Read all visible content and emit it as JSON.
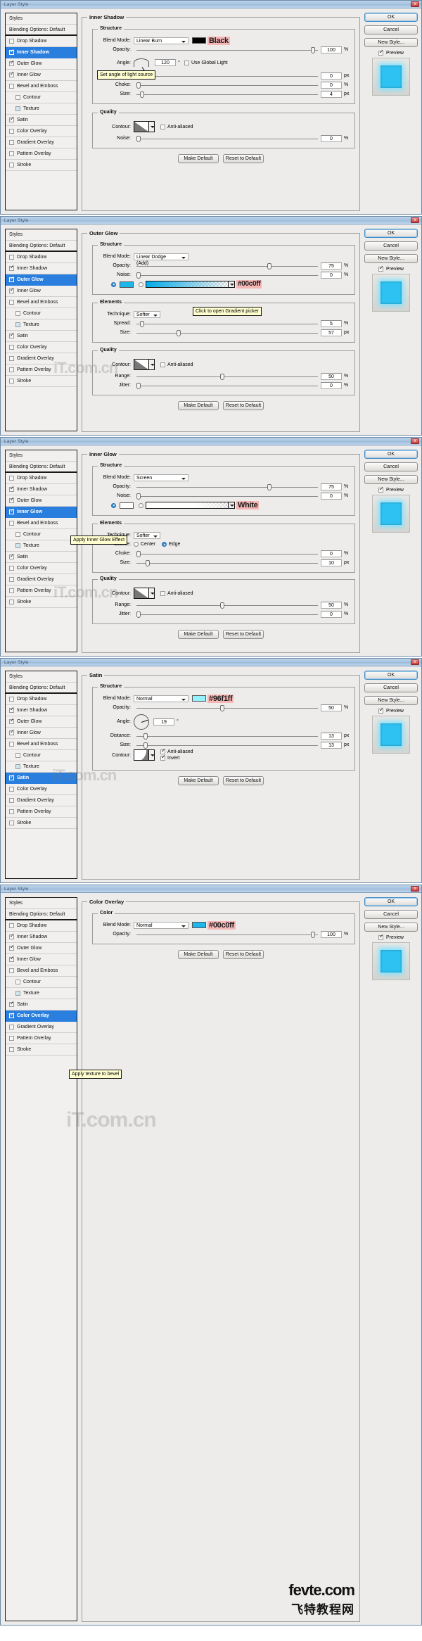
{
  "window": {
    "title": "Layer Style",
    "close_label": "x"
  },
  "styles_list": {
    "header": "Styles",
    "blending_options": "Blending Options: Default",
    "items": [
      {
        "label": "Drop Shadow",
        "checked": false,
        "indent": false
      },
      {
        "label": "Inner Shadow",
        "checked": true,
        "indent": false
      },
      {
        "label": "Outer Glow",
        "checked": true,
        "indent": false
      },
      {
        "label": "Inner Glow",
        "checked": true,
        "indent": false
      },
      {
        "label": "Bevel and Emboss",
        "checked": false,
        "indent": false
      },
      {
        "label": "Contour",
        "checked": false,
        "indent": true
      },
      {
        "label": "Texture",
        "checked": false,
        "indent": true
      },
      {
        "label": "Satin",
        "checked": true,
        "indent": false
      },
      {
        "label": "Color Overlay",
        "checked": true,
        "indent": false
      },
      {
        "label": "Gradient Overlay",
        "checked": false,
        "indent": false
      },
      {
        "label": "Pattern Overlay",
        "checked": false,
        "indent": false
      },
      {
        "label": "Stroke",
        "checked": false,
        "indent": false
      }
    ]
  },
  "buttons": {
    "ok": "OK",
    "cancel": "Cancel",
    "new_style": "New Style...",
    "preview": "Preview",
    "make_default": "Make Default",
    "reset_to_default": "Reset to Default"
  },
  "labels": {
    "structure": "Structure",
    "quality": "Quality",
    "elements": "Elements",
    "color": "Color",
    "blend_mode": "Blend Mode:",
    "opacity": "Opacity:",
    "angle": "Angle:",
    "distance": "Distance:",
    "choke": "Choke:",
    "size": "Size:",
    "spread": "Spread:",
    "noise": "Noise:",
    "contour": "Contour:",
    "technique": "Technique:",
    "source": "Source:",
    "range": "Range:",
    "jitter": "Jitter:",
    "anti_aliased": "Anti-aliased",
    "use_global_light": "Use Global Light",
    "invert": "Invert",
    "center": "Center",
    "edge": "Edge",
    "pct": "%",
    "px": "px",
    "deg": "°"
  },
  "panels": [
    {
      "id": "inner-shadow",
      "title": "Inner Shadow",
      "tooltip": "Set angle of light source",
      "selected_style": "Inner Shadow",
      "blend_mode": "Linear Burn",
      "color_tag": "Black",
      "color_hex": "#000000",
      "opacity": "100",
      "angle": "120",
      "distance": "0",
      "choke": "0",
      "size": "4",
      "noise": "0"
    },
    {
      "id": "outer-glow",
      "title": "Outer Glow",
      "tooltip": "Click to open Gradient picker",
      "selected_style": "Outer Glow",
      "blend_mode": "Linear Dodge (Add)",
      "color_tag": "#00c0ff",
      "color_hex": "#00c0ff",
      "opacity": "75",
      "noise": "0",
      "technique": "Softer",
      "spread": "5",
      "size": "57",
      "range": "50",
      "jitter": "0"
    },
    {
      "id": "inner-glow",
      "title": "Inner Glow",
      "tooltip": "Apply Inner Glow Effect",
      "selected_style": "Inner Glow",
      "blend_mode": "Screen",
      "color_tag": "White",
      "color_hex": "#ffffff",
      "opacity": "75",
      "noise": "0",
      "technique": "Softer",
      "source": "Edge",
      "choke": "0",
      "size": "10",
      "range": "50",
      "jitter": "0"
    },
    {
      "id": "satin",
      "title": "Satin",
      "tooltip": "",
      "selected_style": "Satin",
      "blend_mode": "Normal",
      "color_tag": "#96f1ff",
      "color_hex": "#96f1ff",
      "opacity": "50",
      "angle": "19",
      "distance": "13",
      "size": "13"
    },
    {
      "id": "color-overlay",
      "title": "Color Overlay",
      "tooltip": "Apply texture to bevel",
      "selected_style": "Color Overlay",
      "blend_mode": "Normal",
      "color_tag": "#00c0ff",
      "color_hex": "#00c0ff",
      "opacity": "100"
    }
  ],
  "watermarks": {
    "it": "iT.com.cn",
    "fevte_line1": "fevte.com",
    "fevte_line2": "飞特教程网"
  }
}
